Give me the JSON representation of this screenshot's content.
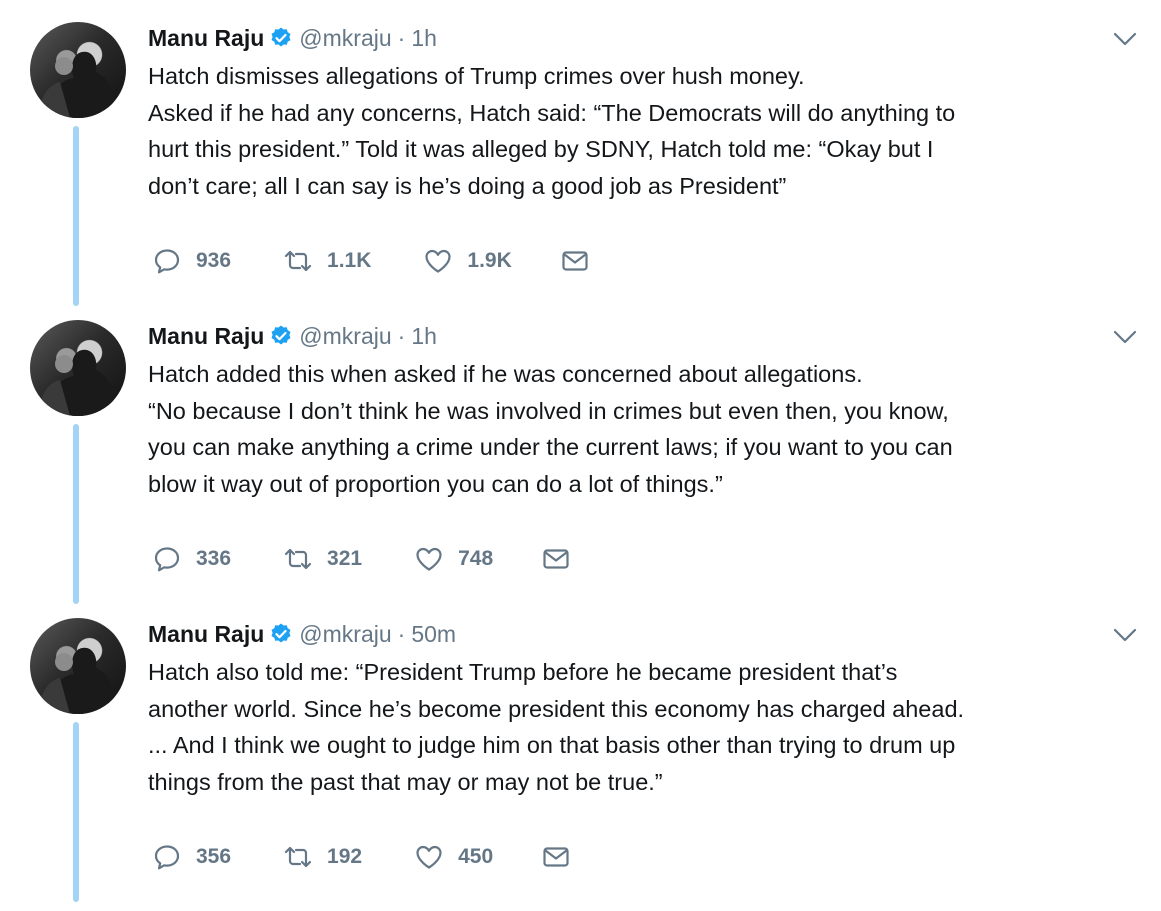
{
  "tweets": [
    {
      "name": "Manu Raju",
      "handle": "@mkraju",
      "separator": "·",
      "time": "1h",
      "lines": [
        "Hatch dismisses allegations of Trump crimes over hush money.",
        "Asked if he had any concerns, Hatch said: “The Democrats will do anything to",
        "hurt this president.” Told it was alleged by SDNY, Hatch told me: “Okay but I",
        "don’t care; all I can say is he’s doing a good job as President”"
      ],
      "replies": "936",
      "retweets": "1.1K",
      "likes": "1.9K"
    },
    {
      "name": "Manu Raju",
      "handle": "@mkraju",
      "separator": "·",
      "time": "1h",
      "lines": [
        "Hatch added this when asked if he was concerned about allegations.",
        "“No because I don’t think he was involved in crimes but even then, you know,",
        "you can make anything a crime under the current laws; if you want to you can",
        "blow it way out of proportion you can do a lot of things.”"
      ],
      "replies": "336",
      "retweets": "321",
      "likes": "748"
    },
    {
      "name": "Manu Raju",
      "handle": "@mkraju",
      "separator": "·",
      "time": "50m",
      "lines": [
        "Hatch also told me: “President Trump before he became president that’s",
        "another world. Since he’s become president this economy has charged ahead.",
        "... And I think we ought to judge him on that basis other than trying to drum up",
        "things from the past that may or may not be true.”"
      ],
      "replies": "356",
      "retweets": "192",
      "likes": "450"
    }
  ],
  "icons": {
    "verified": "verified-badge-icon",
    "caret": "chevron-down-icon",
    "reply": "reply-icon",
    "retweet": "retweet-icon",
    "like": "heart-icon",
    "mail": "envelope-icon"
  },
  "colors": {
    "verified_blue": "#1da1f2",
    "thread_line": "#a3d3f5",
    "secondary_text": "#657786",
    "primary_text": "#14171a"
  }
}
